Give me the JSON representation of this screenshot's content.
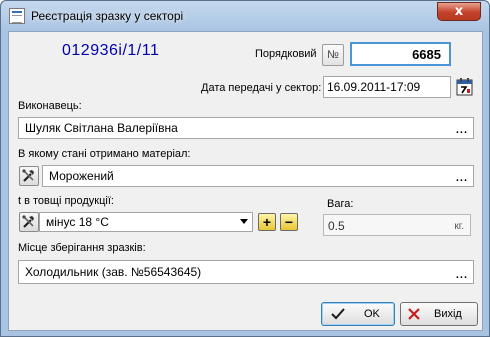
{
  "window": {
    "title": "Реєстрація зразку у секторі",
    "close_label": "x"
  },
  "sample": {
    "code": "012936i/1/11",
    "ordinal_label": "Порядковий",
    "ordinal_button": "№",
    "ordinal_value": "6685",
    "transfer_date_label": "Дата передачі у сектор:",
    "transfer_date_value": "16.09.2011-17:09"
  },
  "executor": {
    "label": "Виконавець:",
    "value": "Шуляк Світлана Валеріївна",
    "ellipsis": "..."
  },
  "condition": {
    "label": "В якому стані отримано матеріал:",
    "value": "Морожений",
    "ellipsis": "..."
  },
  "temperature": {
    "label": "t в товщі продукції:",
    "selected": "мінус 18 °C",
    "plus_label": "+",
    "minus_label": "−"
  },
  "weight": {
    "label": "Вага:",
    "value": "0.5",
    "unit": "кг."
  },
  "storage": {
    "label": "Місце зберігання зразків:",
    "value": "Холодильник (зав. №56543645)",
    "ellipsis": "..."
  },
  "buttons": {
    "ok": "OK",
    "exit": "Вихід"
  },
  "icons": {
    "calendar": "calendar-icon",
    "tools": "tools-icon",
    "check": "checkmark-icon",
    "cross": "cross-icon"
  }
}
